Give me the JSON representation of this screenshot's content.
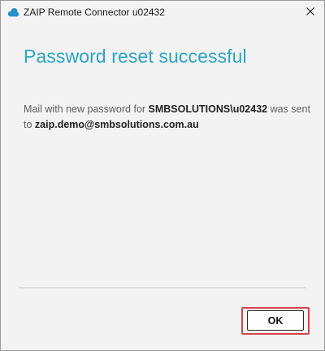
{
  "window": {
    "title": "ZAIP Remote Connector u02432",
    "icon": "cloud-app-icon",
    "close_icon": "close-icon"
  },
  "dialog": {
    "heading": "Password reset successful",
    "message": {
      "part1": "Mail with new password for ",
      "account": "SMBSOLUTIONS\\u02432",
      "part2": " was sent to ",
      "email": "zaip.demo@smbsolutions.com.au"
    },
    "ok_label": "OK"
  },
  "colors": {
    "heading": "#2aa6c3",
    "app_icon": "#2a8ec8",
    "highlight": "#d9424d",
    "background": "#f3f3f3"
  }
}
